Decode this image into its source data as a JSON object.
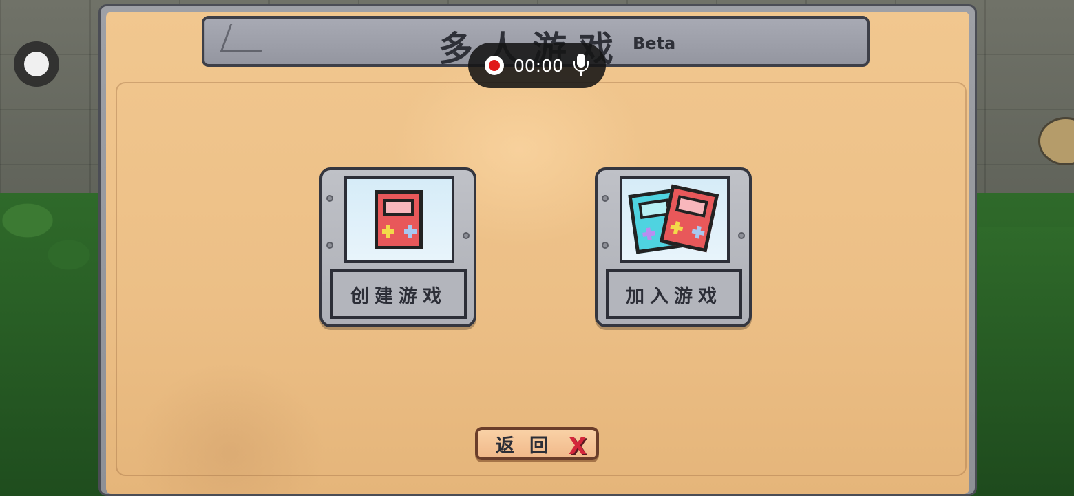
{
  "dialog": {
    "title": "多人游戏",
    "badge": "Beta"
  },
  "recorder": {
    "time": "00:00",
    "icons": [
      "record-icon",
      "microphone-icon"
    ]
  },
  "floating_ball": {
    "icon": "floating-assistant-icon"
  },
  "menu": {
    "create": {
      "label": "创建游戏",
      "icon": "single-gameboy-icon"
    },
    "join": {
      "label": "加入游戏",
      "icon": "two-gameboys-icon"
    }
  },
  "back_button": {
    "label": "返回",
    "icon": "close-x-icon"
  },
  "colors": {
    "parchment": "#ecbf86",
    "stone": "#a8aab4",
    "outline": "#34363f",
    "accent_red": "#d3263b",
    "gameboy_red": "#e8585a",
    "gameboy_cyan": "#4fd3e0"
  }
}
